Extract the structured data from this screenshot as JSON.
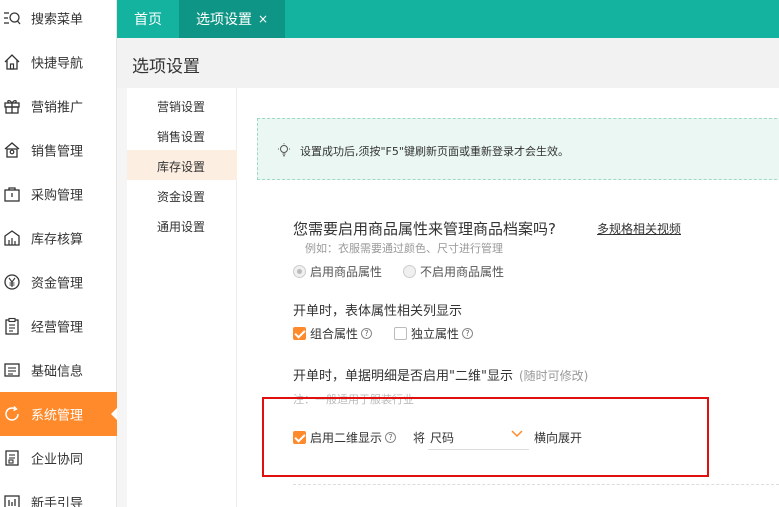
{
  "sidebar": {
    "items": [
      {
        "label": "搜索菜单",
        "icon": "search-menu-icon"
      },
      {
        "label": "快捷导航",
        "icon": "home-icon"
      },
      {
        "label": "营销推广",
        "icon": "gift-icon"
      },
      {
        "label": "销售管理",
        "icon": "shop-icon"
      },
      {
        "label": "采购管理",
        "icon": "bag-icon"
      },
      {
        "label": "库存核算",
        "icon": "warehouse-icon"
      },
      {
        "label": "资金管理",
        "icon": "yen-icon"
      },
      {
        "label": "经营管理",
        "icon": "clipboard-icon"
      },
      {
        "label": "基础信息",
        "icon": "info-card-icon"
      },
      {
        "label": "系统管理",
        "icon": "refresh-icon"
      },
      {
        "label": "企业协同",
        "icon": "document-icon"
      },
      {
        "label": "新手引导",
        "icon": "guide-icon"
      }
    ],
    "active_index": 9
  },
  "tabs": {
    "home": "首页",
    "current": "选项设置",
    "close": "×"
  },
  "page": {
    "title": "选项设置"
  },
  "submenu": {
    "items": [
      "营销设置",
      "销售设置",
      "库存设置",
      "资金设置",
      "通用设置"
    ],
    "active_index": 2
  },
  "notice": {
    "text": "设置成功后,须按\"F5\"键刷新页面或重新登录才会生效。"
  },
  "attributes": {
    "question": "您需要启用商品属性来管理商品档案吗?",
    "link": "多规格相关视频",
    "hint": "例如：衣服需要通过颜色、尺寸进行管理",
    "option_enable": "启用商品属性",
    "option_disable": "不启用商品属性"
  },
  "order_columns": {
    "title": "开单时，表体属性相关列显示",
    "combined": "组合属性",
    "independent": "独立属性"
  },
  "two_dim": {
    "title": "开单时，单据明细是否启用\"二维\"显示",
    "subtitle": "(随时可修改)",
    "note": "注：一般适用于服装行业",
    "enable_label": "启用二维显示",
    "will": "将",
    "select_value": "尺码",
    "expand": "横向展开"
  },
  "colors": {
    "teal": "#13b3a0",
    "teal_dark": "#0f9585",
    "orange": "#ff8a2b",
    "red_box": "#e01010"
  }
}
